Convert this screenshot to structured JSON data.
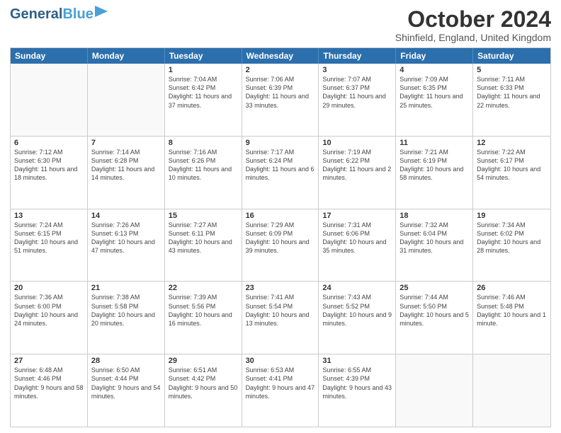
{
  "header": {
    "logo_line1": "General",
    "logo_line2": "Blue",
    "month_title": "October 2024",
    "location": "Shinfield, England, United Kingdom"
  },
  "days_of_week": [
    "Sunday",
    "Monday",
    "Tuesday",
    "Wednesday",
    "Thursday",
    "Friday",
    "Saturday"
  ],
  "weeks": [
    [
      {
        "day": "",
        "info": ""
      },
      {
        "day": "",
        "info": ""
      },
      {
        "day": "1",
        "info": "Sunrise: 7:04 AM\nSunset: 6:42 PM\nDaylight: 11 hours and 37 minutes."
      },
      {
        "day": "2",
        "info": "Sunrise: 7:06 AM\nSunset: 6:39 PM\nDaylight: 11 hours and 33 minutes."
      },
      {
        "day": "3",
        "info": "Sunrise: 7:07 AM\nSunset: 6:37 PM\nDaylight: 11 hours and 29 minutes."
      },
      {
        "day": "4",
        "info": "Sunrise: 7:09 AM\nSunset: 6:35 PM\nDaylight: 11 hours and 25 minutes."
      },
      {
        "day": "5",
        "info": "Sunrise: 7:11 AM\nSunset: 6:33 PM\nDaylight: 11 hours and 22 minutes."
      }
    ],
    [
      {
        "day": "6",
        "info": "Sunrise: 7:12 AM\nSunset: 6:30 PM\nDaylight: 11 hours and 18 minutes."
      },
      {
        "day": "7",
        "info": "Sunrise: 7:14 AM\nSunset: 6:28 PM\nDaylight: 11 hours and 14 minutes."
      },
      {
        "day": "8",
        "info": "Sunrise: 7:16 AM\nSunset: 6:26 PM\nDaylight: 11 hours and 10 minutes."
      },
      {
        "day": "9",
        "info": "Sunrise: 7:17 AM\nSunset: 6:24 PM\nDaylight: 11 hours and 6 minutes."
      },
      {
        "day": "10",
        "info": "Sunrise: 7:19 AM\nSunset: 6:22 PM\nDaylight: 11 hours and 2 minutes."
      },
      {
        "day": "11",
        "info": "Sunrise: 7:21 AM\nSunset: 6:19 PM\nDaylight: 10 hours and 58 minutes."
      },
      {
        "day": "12",
        "info": "Sunrise: 7:22 AM\nSunset: 6:17 PM\nDaylight: 10 hours and 54 minutes."
      }
    ],
    [
      {
        "day": "13",
        "info": "Sunrise: 7:24 AM\nSunset: 6:15 PM\nDaylight: 10 hours and 51 minutes."
      },
      {
        "day": "14",
        "info": "Sunrise: 7:26 AM\nSunset: 6:13 PM\nDaylight: 10 hours and 47 minutes."
      },
      {
        "day": "15",
        "info": "Sunrise: 7:27 AM\nSunset: 6:11 PM\nDaylight: 10 hours and 43 minutes."
      },
      {
        "day": "16",
        "info": "Sunrise: 7:29 AM\nSunset: 6:09 PM\nDaylight: 10 hours and 39 minutes."
      },
      {
        "day": "17",
        "info": "Sunrise: 7:31 AM\nSunset: 6:06 PM\nDaylight: 10 hours and 35 minutes."
      },
      {
        "day": "18",
        "info": "Sunrise: 7:32 AM\nSunset: 6:04 PM\nDaylight: 10 hours and 31 minutes."
      },
      {
        "day": "19",
        "info": "Sunrise: 7:34 AM\nSunset: 6:02 PM\nDaylight: 10 hours and 28 minutes."
      }
    ],
    [
      {
        "day": "20",
        "info": "Sunrise: 7:36 AM\nSunset: 6:00 PM\nDaylight: 10 hours and 24 minutes."
      },
      {
        "day": "21",
        "info": "Sunrise: 7:38 AM\nSunset: 5:58 PM\nDaylight: 10 hours and 20 minutes."
      },
      {
        "day": "22",
        "info": "Sunrise: 7:39 AM\nSunset: 5:56 PM\nDaylight: 10 hours and 16 minutes."
      },
      {
        "day": "23",
        "info": "Sunrise: 7:41 AM\nSunset: 5:54 PM\nDaylight: 10 hours and 13 minutes."
      },
      {
        "day": "24",
        "info": "Sunrise: 7:43 AM\nSunset: 5:52 PM\nDaylight: 10 hours and 9 minutes."
      },
      {
        "day": "25",
        "info": "Sunrise: 7:44 AM\nSunset: 5:50 PM\nDaylight: 10 hours and 5 minutes."
      },
      {
        "day": "26",
        "info": "Sunrise: 7:46 AM\nSunset: 5:48 PM\nDaylight: 10 hours and 1 minute."
      }
    ],
    [
      {
        "day": "27",
        "info": "Sunrise: 6:48 AM\nSunset: 4:46 PM\nDaylight: 9 hours and 58 minutes."
      },
      {
        "day": "28",
        "info": "Sunrise: 6:50 AM\nSunset: 4:44 PM\nDaylight: 9 hours and 54 minutes."
      },
      {
        "day": "29",
        "info": "Sunrise: 6:51 AM\nSunset: 4:42 PM\nDaylight: 9 hours and 50 minutes."
      },
      {
        "day": "30",
        "info": "Sunrise: 6:53 AM\nSunset: 4:41 PM\nDaylight: 9 hours and 47 minutes."
      },
      {
        "day": "31",
        "info": "Sunrise: 6:55 AM\nSunset: 4:39 PM\nDaylight: 9 hours and 43 minutes."
      },
      {
        "day": "",
        "info": ""
      },
      {
        "day": "",
        "info": ""
      }
    ]
  ]
}
